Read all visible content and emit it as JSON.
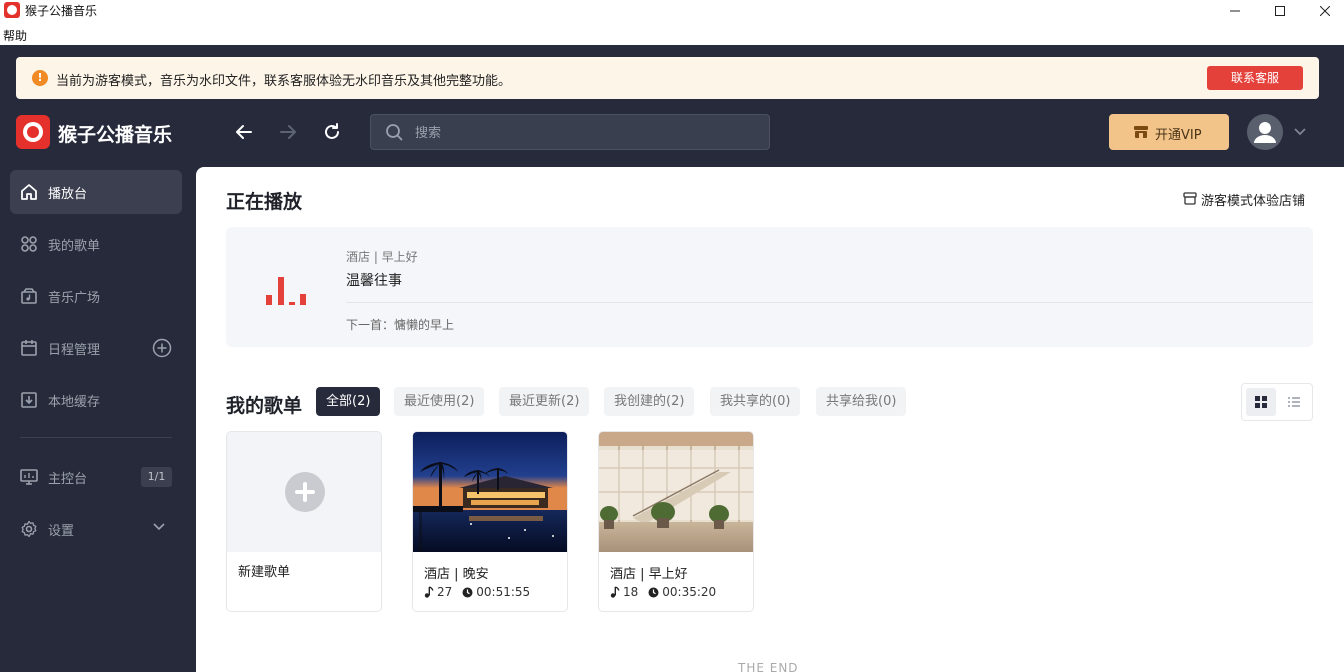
{
  "window": {
    "title": "猴子公播音乐",
    "controls": [
      "minimize-icon",
      "maximize-icon",
      "close-icon"
    ]
  },
  "menubar": {
    "help": "帮助"
  },
  "notice": {
    "text": "当前为游客模式，音乐为水印文件，联系客服体验无水印音乐及其他完整功能。",
    "button": "联系客服",
    "icon": "warning-icon"
  },
  "header": {
    "brand": "猴子公播音乐",
    "search_placeholder": "搜索",
    "vip_label": "开通VIP"
  },
  "sidebar": {
    "items": [
      {
        "label": "播放台",
        "icon": "home-icon",
        "active": true
      },
      {
        "label": "我的歌单",
        "icon": "playlist-icon"
      },
      {
        "label": "音乐广场",
        "icon": "music-square-icon"
      },
      {
        "label": "日程管理",
        "icon": "calendar-icon"
      },
      {
        "label": "本地缓存",
        "icon": "download-icon"
      },
      {
        "label": "主控台",
        "icon": "monitor-icon",
        "badge": "1/1"
      },
      {
        "label": "设置",
        "icon": "settings-icon"
      }
    ]
  },
  "now_playing": {
    "title": "正在播放",
    "shop_link": "游客模式体验店铺",
    "playlist": "酒店 | 早上好",
    "song": "温馨往事",
    "next": "下一首：慵懒的早上"
  },
  "my_playlists": {
    "title": "我的歌单",
    "filters": [
      {
        "label": "全部(2)",
        "active": true
      },
      {
        "label": "最近使用(2)"
      },
      {
        "label": "最近更新(2)"
      },
      {
        "label": "我创建的(2)"
      },
      {
        "label": "我共享的(0)"
      },
      {
        "label": "共享给我(0)"
      }
    ],
    "new_label": "新建歌单",
    "cards": [
      {
        "name": "酒店 | 晚安",
        "count": "27",
        "duration": "00:51:55"
      },
      {
        "name": "酒店 | 早上好",
        "count": "18",
        "duration": "00:35:20"
      }
    ]
  },
  "footer": {
    "end": "THE END"
  },
  "colors": {
    "accent": "#e4413b",
    "sidebar_bg": "#262a3b",
    "vip": "#f3c48a"
  }
}
